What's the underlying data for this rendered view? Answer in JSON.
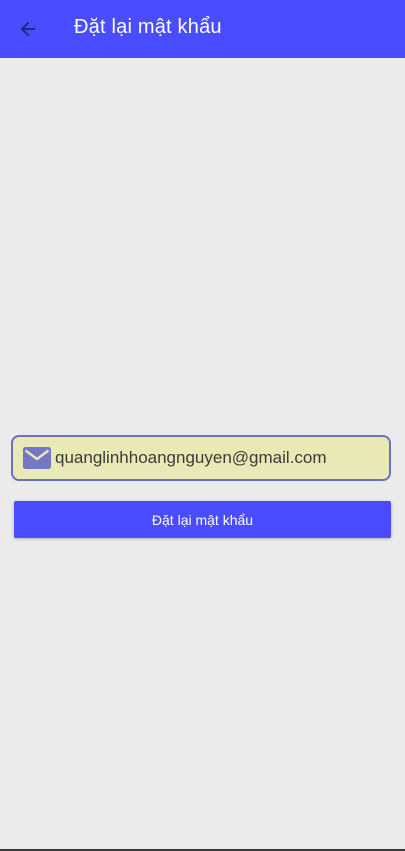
{
  "app_bar": {
    "title": "Đặt lại mật khẩu",
    "color": "#4a4cff"
  },
  "icons": {
    "back": "arrow-back-icon",
    "email": "mail-icon"
  },
  "email_field": {
    "value": "quanglinhhoangnguyen@gmail.com",
    "background": "#e9e9b6",
    "border": "#6a6fc8"
  },
  "reset_button": {
    "label": "Đặt lại mật khẩu"
  }
}
